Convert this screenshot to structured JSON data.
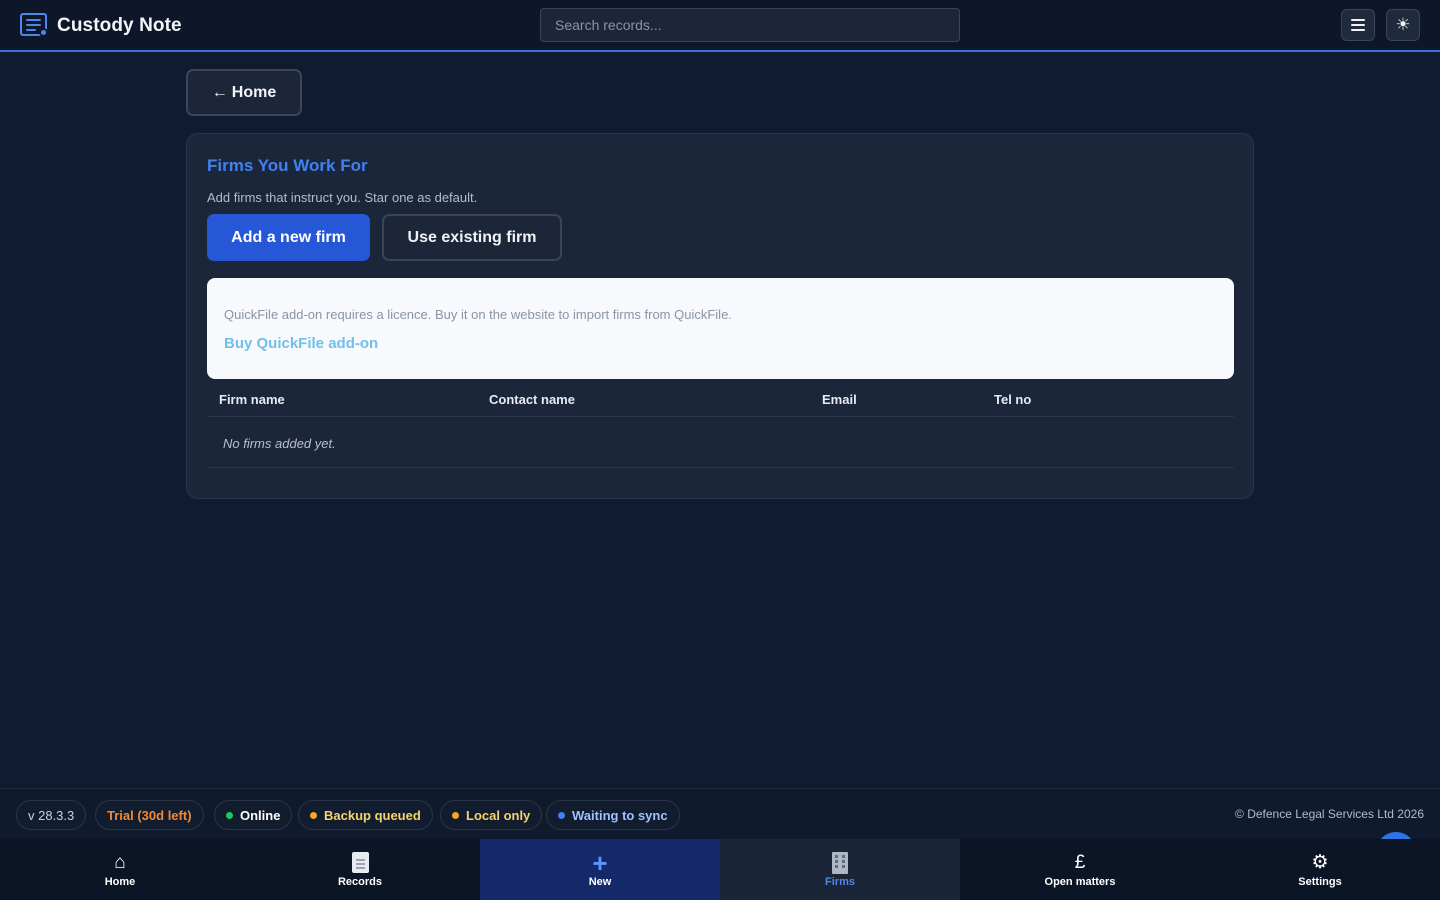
{
  "app": {
    "title": "Custody Note"
  },
  "search": {
    "placeholder": "Search records..."
  },
  "header": {
    "menu_icon": "hamburger-icon",
    "theme_icon": "sun-icon",
    "theme_glyph": "☀"
  },
  "back": {
    "arrow": "←",
    "label": "Home"
  },
  "firms": {
    "title": "Firms You Work For",
    "subtitle": "Add firms that instruct you. Star one as default.",
    "add_button": "Add a new firm",
    "existing_button": "Use existing firm",
    "notice": {
      "text": "QuickFile add-on requires a licence. Buy it on the website to import firms from QuickFile.",
      "link": "Buy QuickFile add-on"
    },
    "table": {
      "columns": [
        "Firm name",
        "Contact name",
        "Email",
        "Tel no"
      ],
      "empty_text": "No firms added yet."
    }
  },
  "status": {
    "version": "v 28.3.3",
    "trial": "Trial (30d left)",
    "online": "Online",
    "backup": "Backup queued",
    "local": "Local only",
    "sync": "Waiting to sync",
    "copyright": "© Defence Legal Services Ltd 2026",
    "colors": {
      "trial": "#f08a35",
      "online": "#22c55e",
      "backup": "#f5a623",
      "local": "#f5a623",
      "sync": "#3b82f6",
      "version": "#c8cfdb"
    }
  },
  "nav": {
    "items": [
      {
        "label": "Home",
        "icon": "home-icon",
        "glyph": "⌂"
      },
      {
        "label": "Records",
        "icon": "document-icon"
      },
      {
        "label": "New",
        "icon": "plus-icon",
        "glyph": "+"
      },
      {
        "label": "Firms",
        "icon": "building-icon",
        "active": true
      },
      {
        "label": "Open matters",
        "icon": "pound-icon",
        "glyph": "£"
      },
      {
        "label": "Settings",
        "icon": "gear-icon",
        "glyph": "⚙"
      }
    ]
  }
}
